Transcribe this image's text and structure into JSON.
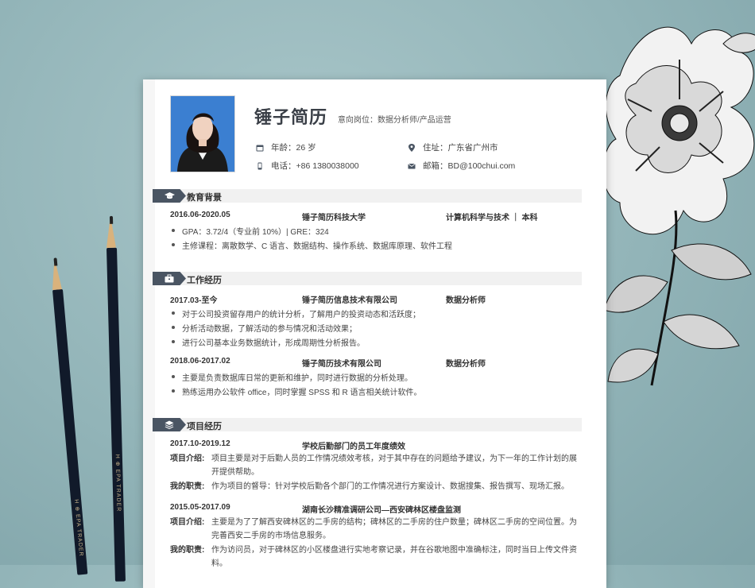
{
  "header": {
    "name": "锤子简历",
    "target": "意向岗位：数据分析师/产品运营",
    "age": "年龄：26 岁",
    "location": "住址：广东省广州市",
    "phone": "电话：+86 1380038000",
    "email": "邮箱：BD@100chui.com"
  },
  "education": {
    "title": "教育背景",
    "period": "2016.06-2020.05",
    "school": "锤子简历科技大学",
    "major": "计算机科学与技术 ｜ 本科",
    "bullets": [
      "GPA：3.72/4（专业前 10%）| GRE：324",
      "主修课程：离散数学、C 语言、数据结构、操作系统、数据库原理、软件工程"
    ]
  },
  "work": {
    "title": "工作经历",
    "jobs": [
      {
        "period": "2017.03-至今",
        "company": "锤子简历信息技术有限公司",
        "role": "数据分析师",
        "bullets": [
          "对于公司投资留存用户的统计分析，了解用户的投资动态和活跃度；",
          "分析活动数据，了解活动的参与情况和活动效果；",
          "进行公司基本业务数据统计，形成周期性分析报告。"
        ]
      },
      {
        "period": "2018.06-2017.02",
        "company": "锤子简历技术有限公司",
        "role": "数据分析师",
        "bullets": [
          "主要是负责数据库日常的更新和维护，同时进行数据的分析处理。",
          "熟练运用办公软件 office，同时掌握 SPSS 和 R 语言相关统计软件。"
        ]
      }
    ]
  },
  "projects": {
    "title": "项目经历",
    "intro_label": "项目介绍:",
    "duty_label": "我的职责:",
    "items": [
      {
        "period": "2017.10-2019.12",
        "name": "学校后勤部门的员工年度绩效",
        "intro": "项目主要是对于后勤人员的工作情况绩效考核，对于其中存在的问题给予建议，为下一年的工作计划的展开提供帮助。",
        "duty": "作为项目的督导：针对学校后勤各个部门的工作情况进行方案设计、数据搜集、报告撰写、现场汇报。"
      },
      {
        "period": "2015.05-2017.09",
        "name": "湖南长沙精准调研公司—西安碑林区楼盘监测",
        "intro": "主要是为了了解西安碑林区的二手房的结构；碑林区的二手房的住户数量；碑林区二手房的空间位置。为完善西安二手房的市场信息服务。",
        "duty": "作为访问员，对于碑林区的小区楼盘进行实地考察记录，并在谷歌地图中准确标注，同时当日上传文件资料。"
      }
    ]
  },
  "pencils": {
    "brand": "H ⊕ EPA TRADER"
  },
  "colors": {
    "accent": "#4a5563",
    "background": "#92b4b8"
  }
}
